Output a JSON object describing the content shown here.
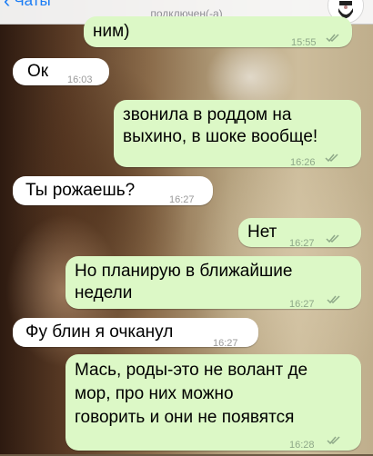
{
  "header": {
    "back_label": "Чаты",
    "status": "подключен(-а)"
  },
  "messages": [
    {
      "dir": "out",
      "text": [
        "ним)"
      ],
      "time": "15:55",
      "read": true
    },
    {
      "dir": "in",
      "text": [
        "Ок"
      ],
      "time": "16:03"
    },
    {
      "dir": "out",
      "text": [
        "звонила в роддом на",
        "выхино, в шоке вообще!"
      ],
      "time": "16:26",
      "read": true
    },
    {
      "dir": "in",
      "text": [
        "Ты рожаешь?"
      ],
      "time": "16:27"
    },
    {
      "dir": "out",
      "text": [
        "Нет"
      ],
      "time": "16:27",
      "read": true
    },
    {
      "dir": "out",
      "text": [
        "Но планирую в ближайшие",
        "недели"
      ],
      "time": "16:27",
      "read": true
    },
    {
      "dir": "in",
      "text": [
        "Фу блин я очканул"
      ],
      "time": "16:27"
    },
    {
      "dir": "out",
      "text": [
        "Мась, роды-это не волант де",
        "мор, про них можно",
        "говорить и они не появятся"
      ],
      "time": "16:28",
      "read": true
    }
  ],
  "colors": {
    "outgoing_bubble": "#dcf8c6",
    "incoming_bubble": "#ffffff",
    "accent": "#1a7cf5",
    "read_ticks": "#8ea888"
  },
  "icons": {
    "back": "chevron-left-icon",
    "avatar": "contact-avatar-icon",
    "read_receipt": "double-check-icon"
  }
}
